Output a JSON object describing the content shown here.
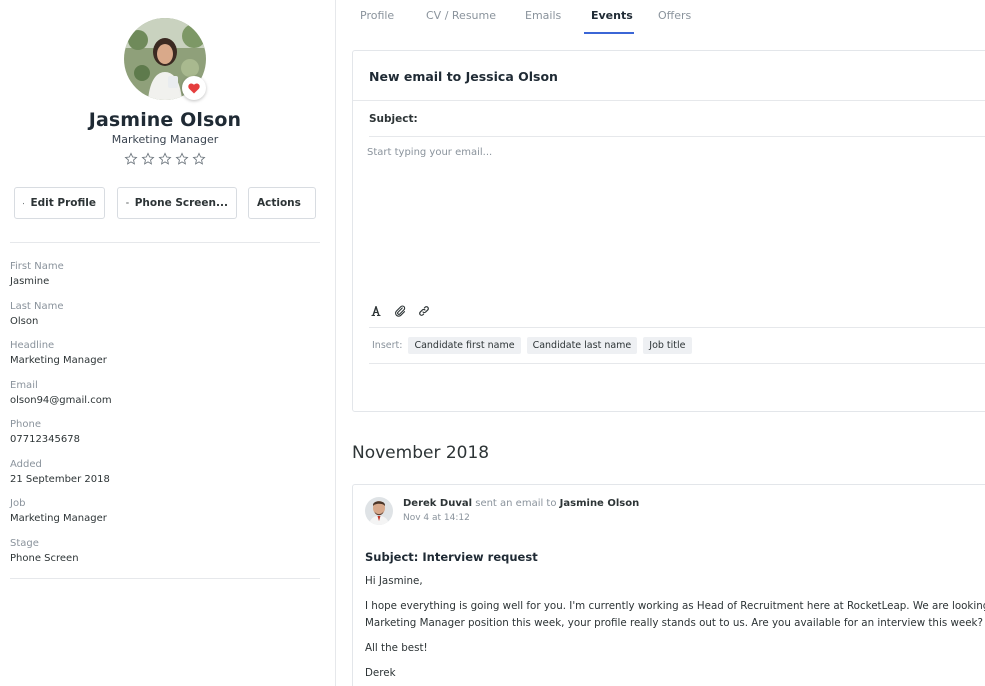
{
  "profile": {
    "name": "Jasmine Olson",
    "headline": "Marketing Manager",
    "favorite_color": "#e53e3e",
    "rating": 0,
    "max_rating": 5
  },
  "buttons": {
    "edit_profile": "Edit Profile",
    "stage": "Phone Screen...",
    "actions": "Actions"
  },
  "fields": [
    {
      "label": "First Name",
      "value": "Jasmine"
    },
    {
      "label": "Last Name",
      "value": "Olson"
    },
    {
      "label": "Headline",
      "value": "Marketing Manager"
    },
    {
      "label": "Email",
      "value": "olson94@gmail.com"
    },
    {
      "label": "Phone",
      "value": "07712345678"
    },
    {
      "label": "Added",
      "value": "21 September 2018"
    },
    {
      "label": "Job",
      "value": "Marketing Manager"
    },
    {
      "label": "Stage",
      "value": "Phone Screen"
    }
  ],
  "tabs": [
    {
      "label": "Profile"
    },
    {
      "label": "CV / Resume"
    },
    {
      "label": "Emails"
    },
    {
      "label": "Events",
      "active": true
    },
    {
      "label": "Offers"
    }
  ],
  "compose": {
    "title": "New email to Jessica Olson",
    "subject_label": "Subject:",
    "subject_value": "",
    "body_placeholder": "Start typing your email...",
    "insert_label": "Insert:",
    "chips": [
      "Candidate first name",
      "Candidate last name",
      "Job title"
    ]
  },
  "timeline": {
    "month": "November 2018",
    "event": {
      "sender": "Derek Duval",
      "action": "sent an email to",
      "recipient": "Jasmine Olson",
      "time": "Nov 4 at 14:12",
      "subject": "Subject: Interview request",
      "lines": [
        "Hi Jasmine,",
        "I hope everything is going well for you. I'm currently working as Head of Recruitment here at RocketLeap. We are looking in",
        "Marketing Manager position this week, your profile really stands out to us. Are you available for an interview this week?",
        "All the best!",
        "Derek"
      ]
    }
  },
  "colors": {
    "accent": "#3b66d6",
    "muted_text": "#8a939c",
    "border": "#e3e6ea"
  }
}
